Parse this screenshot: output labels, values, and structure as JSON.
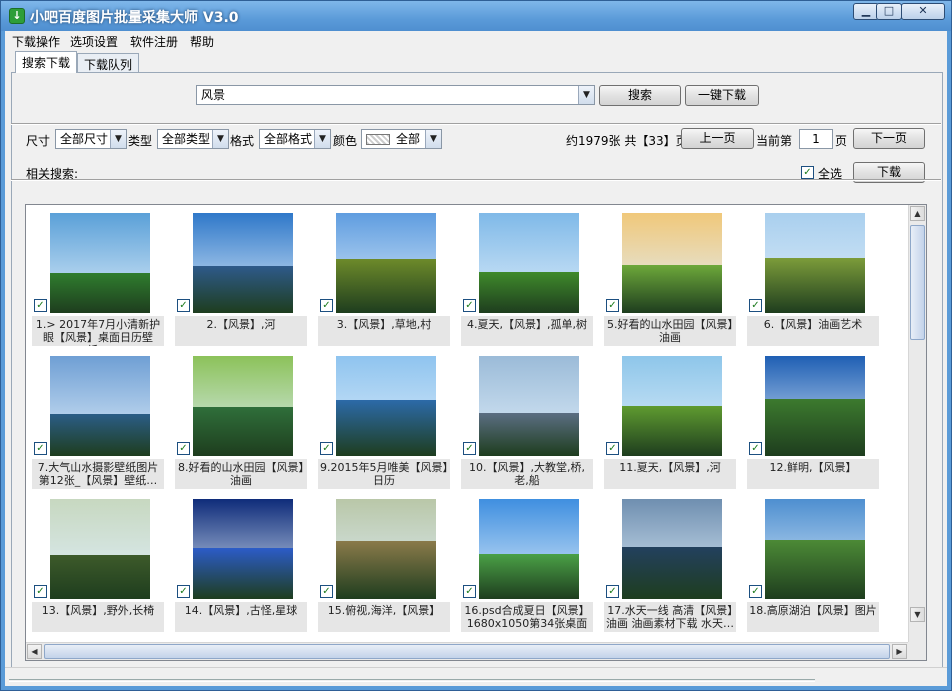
{
  "window": {
    "title": "小吧百度图片批量采集大师 V3.0",
    "icon": "download-arrow-icon",
    "controls": {
      "minimize": "▁",
      "maximize": "□",
      "close": "✕"
    }
  },
  "menu": [
    "下载操作",
    "选项设置",
    "软件注册",
    "帮助"
  ],
  "tabs": [
    {
      "label": "搜索下载",
      "active": true
    },
    {
      "label": "下载队列",
      "active": false
    }
  ],
  "search": {
    "value": "风景",
    "search_button": "搜索",
    "download_all_button": "一键下载"
  },
  "filters": {
    "size_label": "尺寸",
    "size_value": "全部尺寸",
    "type_label": "类型",
    "type_value": "全部类型",
    "format_label": "格式",
    "format_value": "全部格式",
    "color_label": "颜色",
    "color_value": "全部"
  },
  "paging": {
    "summary": "约1979张 共【33】页",
    "prev_button": "上一页",
    "current_label": "当前第",
    "current_page": "1",
    "page_unit": "页",
    "next_button": "下一页"
  },
  "related": {
    "label": "相关搜索:",
    "select_all_label": "全选",
    "download_button": "下载"
  },
  "colors": {
    "titlebar": "#5b9bd9",
    "client": "#f0f0f0",
    "caption_bg": "#e6e6e6"
  },
  "results": [
    {
      "caption": "1.> 2017年7月小清新护眼【风景】桌面日历壁纸…",
      "checked": true
    },
    {
      "caption": "2.【风景】,河",
      "checked": true
    },
    {
      "caption": "3.【风景】,草地,村",
      "checked": true
    },
    {
      "caption": "4.夏天,【风景】,孤单,树",
      "checked": true
    },
    {
      "caption": "5.好看的山水田园【风景】油画",
      "checked": true
    },
    {
      "caption": "6.【风景】油画艺术",
      "checked": true
    },
    {
      "caption": "7.大气山水摄影壁纸图片第12张_【风景】壁纸…",
      "checked": true
    },
    {
      "caption": "8.好看的山水田园【风景】油画",
      "checked": true
    },
    {
      "caption": "9.2015年5月唯美【风景】日历",
      "checked": true
    },
    {
      "caption": "10.【风景】,大教堂,桥,老,船",
      "checked": true
    },
    {
      "caption": "11.夏天,【风景】,河",
      "checked": true
    },
    {
      "caption": "12.鲜明,【风景】",
      "checked": true
    },
    {
      "caption": "13.【风景】,野外,长椅",
      "checked": true
    },
    {
      "caption": "14.【风景】,古怪,星球",
      "checked": true
    },
    {
      "caption": "15.俯视,海洋,【风景】",
      "checked": true
    },
    {
      "caption": "16.psd合成夏日【风景】1680x1050第34张桌面",
      "checked": true
    },
    {
      "caption": "17.水天一线 高清【风景】油画 油画素材下载 水天…",
      "checked": true
    },
    {
      "caption": "18.高原湖泊【风景】图片",
      "checked": true
    }
  ]
}
